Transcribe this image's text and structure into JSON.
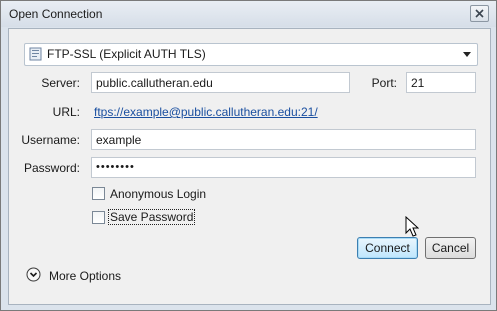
{
  "window": {
    "title": "Open Connection",
    "close_icon": "close-icon"
  },
  "protocol": {
    "icon": "ftp-ssl-icon",
    "selected": "FTP-SSL (Explicit AUTH TLS)"
  },
  "form": {
    "server_label": "Server:",
    "server_value": "public.callutheran.edu",
    "port_label": "Port:",
    "port_value": "21",
    "url_label": "URL:",
    "url_value": "ftps://example@public.callutheran.edu:21/",
    "username_label": "Username:",
    "username_value": "example",
    "password_label": "Password:",
    "password_value": "••••••••"
  },
  "options": {
    "anonymous_login": {
      "label": "Anonymous Login",
      "checked": false
    },
    "save_password": {
      "label": "Save Password",
      "checked": false
    }
  },
  "buttons": {
    "connect": "Connect",
    "cancel": "Cancel"
  },
  "more_options": {
    "label": "More Options",
    "icon": "chevron-down-circle-icon"
  },
  "colors": {
    "link": "#1a4fa0",
    "default_button_border": "#3c7fb1",
    "default_button_fill": "#bee6fd"
  }
}
